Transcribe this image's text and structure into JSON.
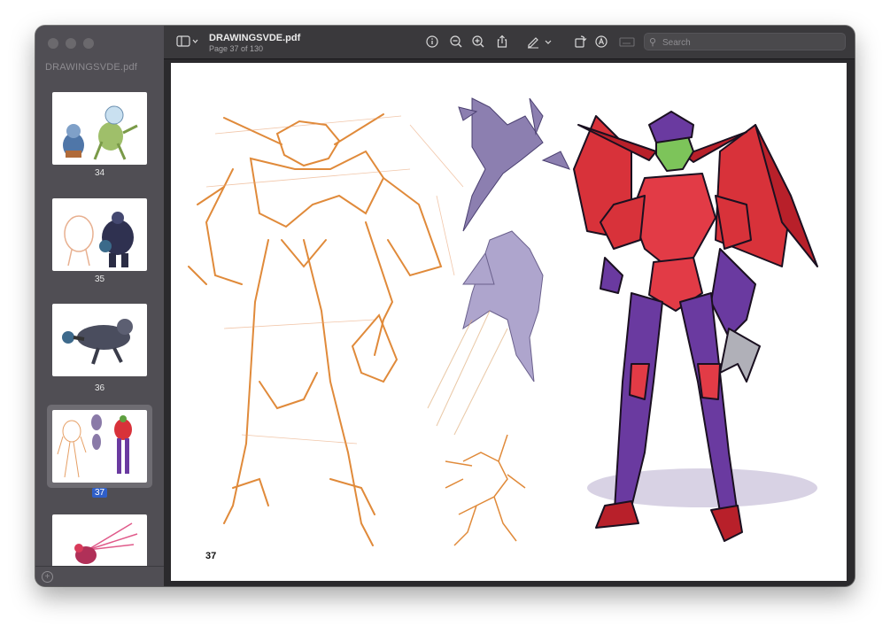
{
  "window": {
    "traffic_lights": [
      "close",
      "minimize",
      "zoom"
    ]
  },
  "sidebar": {
    "title": "DRAWINGSVDE.pdf",
    "thumbnails": [
      {
        "label": "34",
        "selected": false
      },
      {
        "label": "35",
        "selected": false
      },
      {
        "label": "36",
        "selected": false
      },
      {
        "label": "37",
        "selected": true
      },
      {
        "label": "",
        "selected": false
      }
    ]
  },
  "toolbar": {
    "title": "DRAWINGSVDE.pdf",
    "subtitle": "Page 37 of 130",
    "icons": [
      "sidebar-toggle-icon",
      "info-icon",
      "zoom-out-icon",
      "zoom-in-icon",
      "share-icon",
      "markup-pen-icon",
      "rotate-icon",
      "annotate-icon",
      "form-fill-icon"
    ],
    "search_placeholder": "Search"
  },
  "page": {
    "page_number": "37"
  },
  "colors": {
    "accent": "#2f5fc9",
    "sketch": "#e08a3a",
    "armor_red": "#d8323a",
    "armor_purple": "#6a3aa0"
  }
}
